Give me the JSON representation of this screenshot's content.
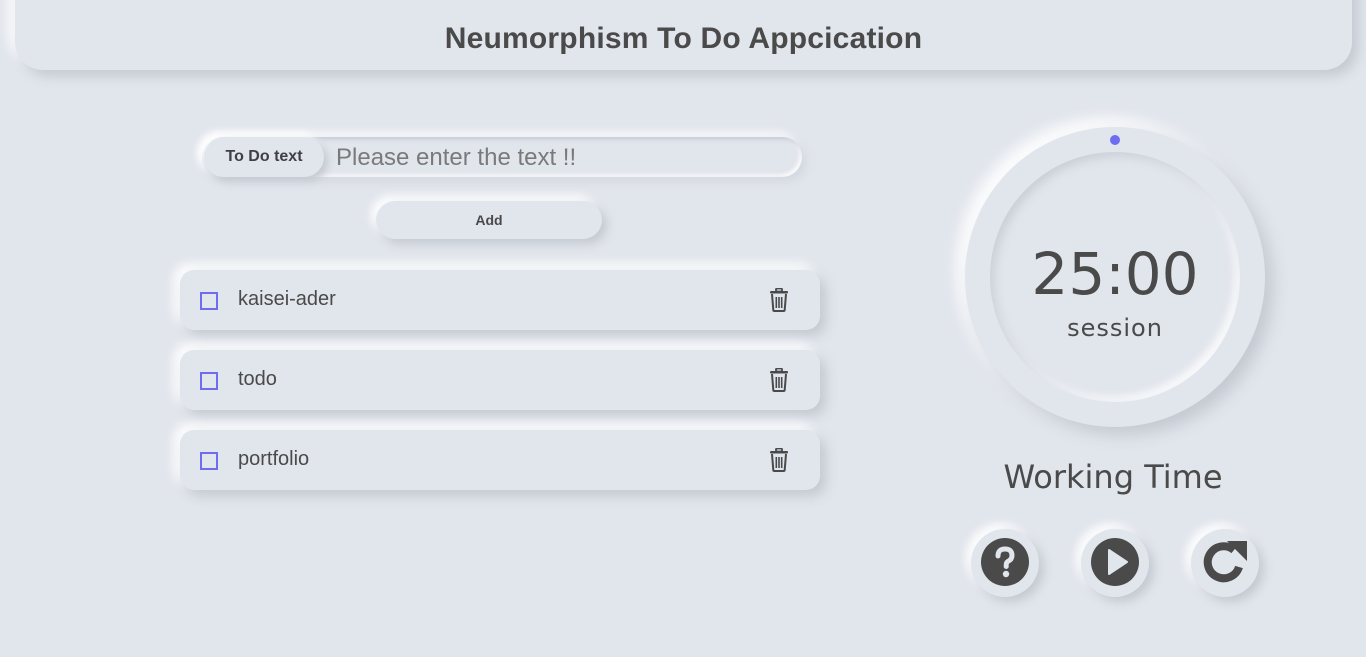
{
  "header": {
    "title": "Neumorphism To Do Appcication"
  },
  "input": {
    "label": "To Do text",
    "placeholder": "Please enter the text !!",
    "value": ""
  },
  "add_button": {
    "label": "Add"
  },
  "todos": [
    {
      "label": "kaisei-ader",
      "checked": false
    },
    {
      "label": "todo",
      "checked": false
    },
    {
      "label": "portfolio",
      "checked": false
    }
  ],
  "timer": {
    "time": "25:00",
    "mode": "session",
    "status": "Working Time",
    "accent_color": "#6e6cf0"
  },
  "controls": {
    "help_icon": "question-circle-icon",
    "play_icon": "play-circle-icon",
    "reset_icon": "redo-icon"
  },
  "colors": {
    "background": "#e1e5ec",
    "text": "#4a4a4a",
    "accent": "#6e6cf0"
  }
}
